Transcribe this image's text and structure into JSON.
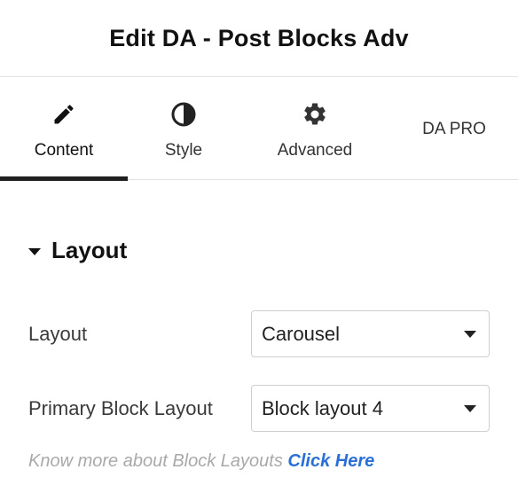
{
  "header": {
    "title": "Edit DA - Post Blocks Adv"
  },
  "tabs": [
    {
      "label": "Content",
      "icon": "pencil-icon",
      "active": true
    },
    {
      "label": "Style",
      "icon": "half-circle-contrast-icon",
      "active": false
    },
    {
      "label": "Advanced",
      "icon": "gear-icon",
      "active": false
    },
    {
      "label": "DA PRO",
      "icon": "",
      "active": false
    }
  ],
  "section": {
    "title": "Layout",
    "fields": [
      {
        "label": "Layout",
        "value": "Carousel"
      },
      {
        "label": "Primary Block Layout",
        "value": "Block layout 4"
      }
    ],
    "help_text": "Know more about Block Layouts",
    "help_link": "Click Here"
  },
  "colors": {
    "accent_link": "#2a6fd6",
    "active_tab_indicator": "#1f1f1f",
    "border": "#e2e2e2"
  }
}
